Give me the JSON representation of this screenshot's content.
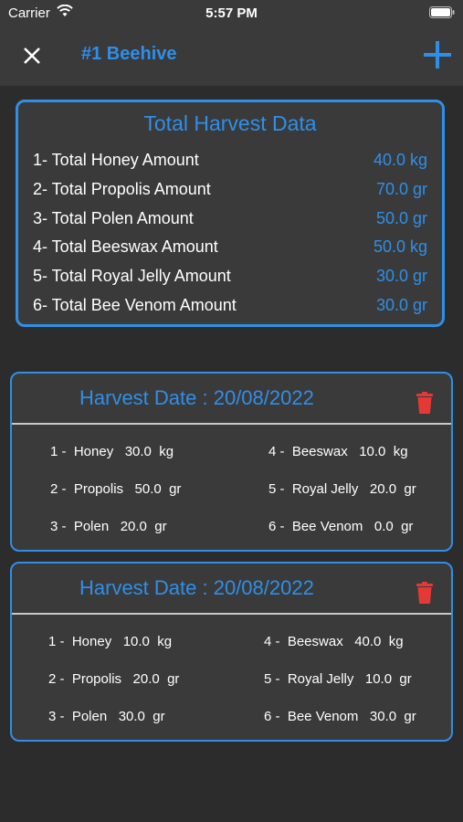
{
  "status": {
    "carrier": "Carrier",
    "time": "5:57 PM"
  },
  "nav": {
    "title": "#1 Beehive"
  },
  "total": {
    "title": "Total Harvest Data",
    "rows": [
      {
        "label": "1- Total Honey Amount",
        "value": "40.0 kg"
      },
      {
        "label": "2- Total Propolis Amount",
        "value": "70.0 gr"
      },
      {
        "label": "3- Total Polen Amount",
        "value": "50.0 gr"
      },
      {
        "label": "4- Total Beeswax Amount",
        "value": "50.0 kg"
      },
      {
        "label": "5- Total Royal Jelly Amount",
        "value": "30.0 gr"
      },
      {
        "label": "6- Total Bee Venom Amount",
        "value": "30.0 gr"
      }
    ]
  },
  "harvests": [
    {
      "date": "Harvest Date : 20/08/2022",
      "items": [
        "1 -  Honey   30.0  kg",
        "2 -  Propolis   50.0  gr",
        "3 -  Polen   20.0  gr",
        "4 -  Beeswax   10.0  kg",
        "5 -  Royal Jelly   20.0  gr",
        "6 -  Bee Venom   0.0  gr"
      ]
    },
    {
      "date": "Harvest Date : 20/08/2022",
      "items": [
        "1 -  Honey   10.0  kg",
        "2 -  Propolis   20.0  gr",
        "3 -  Polen   30.0  gr",
        "4 -  Beeswax   40.0  kg",
        "5 -  Royal Jelly   10.0  gr",
        "6 -  Bee Venom   30.0  gr"
      ]
    }
  ],
  "colors": {
    "accent": "#2f8fe8",
    "delete": "#e53935",
    "background": "#2c2c2c",
    "card": "#3a3a3a"
  },
  "icons": {
    "close": "close-icon",
    "add": "plus-icon",
    "delete": "trash-icon"
  }
}
